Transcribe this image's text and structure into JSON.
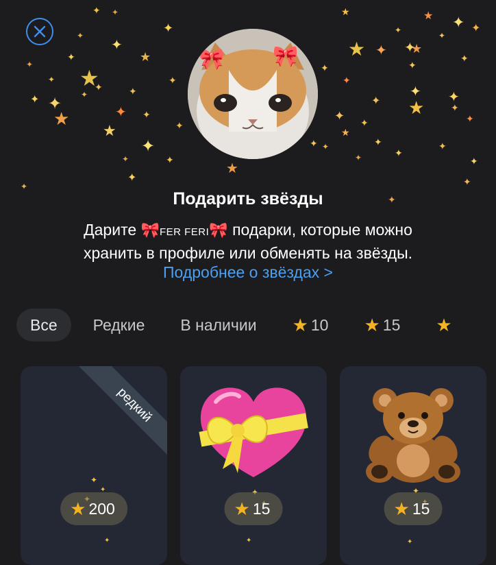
{
  "header": {
    "close_icon": "close-icon",
    "title": "Подарить звёзды",
    "desc_prefix": "Дарите ",
    "user_name": "FER FERI",
    "desc_suffix": " подарки, которые можно",
    "desc_line2": "хранить в профиле или обменять на звёзды.",
    "learn_more": "Подробнее о звёздах >"
  },
  "tabs": [
    {
      "label": "Все",
      "active": true
    },
    {
      "label": "Редкие"
    },
    {
      "label": "В наличии"
    },
    {
      "label": "10",
      "icon": "star-icon"
    },
    {
      "label": "15",
      "icon": "star-icon"
    }
  ],
  "gifts": [
    {
      "ribbon": "редкий",
      "price": "200",
      "image": "empty"
    },
    {
      "price": "15",
      "image": "heart-with-bow-icon"
    },
    {
      "price": "15",
      "image": "teddy-bear-icon"
    }
  ],
  "colors": {
    "background": "#1c1c1e",
    "card": "#232834",
    "accent": "#4aa0f2",
    "star": "#f4b324"
  }
}
